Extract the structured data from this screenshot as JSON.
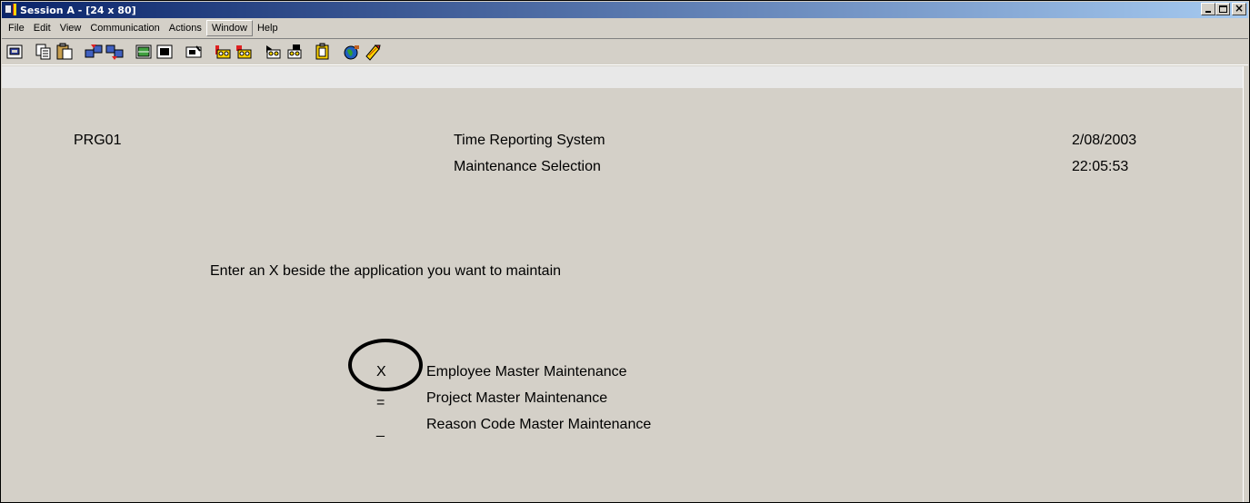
{
  "window": {
    "title": "Session A - [24 x 80]",
    "buttons": {
      "minimize": "minimize",
      "maximize": "maximize",
      "close": "close"
    }
  },
  "menu": [
    "File",
    "Edit",
    "View",
    "Communication",
    "Actions",
    "Window",
    "Help"
  ],
  "menu_active": "Window",
  "toolbar": {
    "icons": [
      "display-session-icon",
      "copy-icon",
      "paste-icon",
      "send-file-icon",
      "receive-file-icon",
      "keyboard-map-icon",
      "color-map-icon",
      "print-screen-icon",
      "macro-record-icon",
      "macro-stop-icon",
      "macro-play-icon",
      "macro-edit-icon",
      "clipboard-icon",
      "globe-icon",
      "help-icon"
    ]
  },
  "terminal": {
    "program_id": "PRG01",
    "title": "Time Reporting System",
    "subtitle": "Maintenance Selection",
    "date": "2/08/2003",
    "time": "22:05:53",
    "instruction": "Enter an X beside the application you want to maintain",
    "options": [
      {
        "value": "X",
        "label": "Employee Master Maintenance"
      },
      {
        "value": "=",
        "label": "Project Master Maintenance"
      },
      {
        "value": "_",
        "label": "Reason Code Master Maintenance"
      }
    ]
  },
  "colors": {
    "titlebar_start": "#0a246a",
    "titlebar_end": "#a6caf0",
    "screen_background": "#e8e8e8",
    "chrome": "#d4d0c8"
  }
}
